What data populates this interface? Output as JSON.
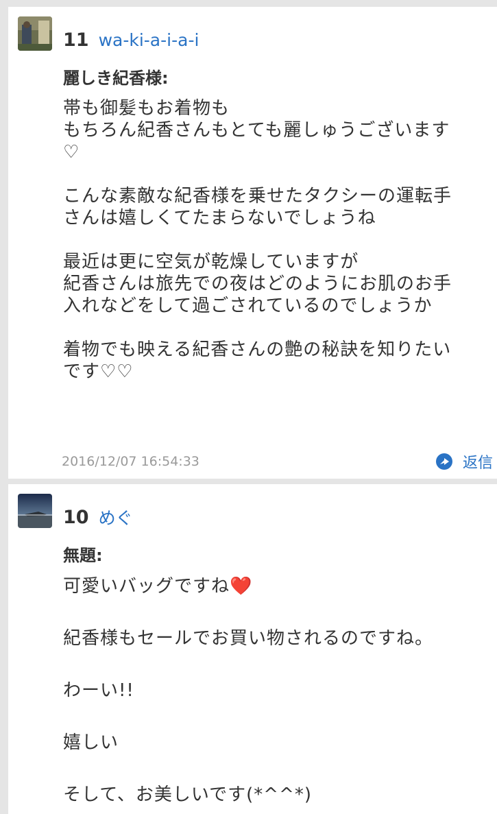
{
  "comments": [
    {
      "number": "11",
      "author": "wa-ki-a-i-a-i",
      "title": "麗しき紀香様:",
      "body": "帯も御髪もお着物も\nもちろん紀香さんもとても麗しゅうございます\n♡\n\nこんな素敵な紀香様を乗せたタクシーの運転手\nさんは嬉しくてたまらないでしょうね\n\n最近は更に空気が乾燥していますが\n紀香さんは旅先での夜はどのようにお肌のお手\n入れなどをして過ごされているのでしょうか\n\n着物でも映える紀香さんの艶の秘訣を知りたい\nです♡♡",
      "timestamp": "2016/12/07 16:54:33",
      "reply_label": "返信",
      "reply_icon": "reply-arrow-circle-icon"
    },
    {
      "number": "10",
      "author": "めぐ",
      "title": "無題:",
      "body": "可愛いバッグですね❤️\n\n紀香様もセールでお買い物されるのですね。\n\nわーい!!\n\n嬉しい\n\nそして、お美しいです(*^^*)"
    }
  ],
  "colors": {
    "link": "#2a73c5",
    "text": "#333333",
    "muted": "#9a9a9a",
    "background": "#e5e5e5"
  }
}
